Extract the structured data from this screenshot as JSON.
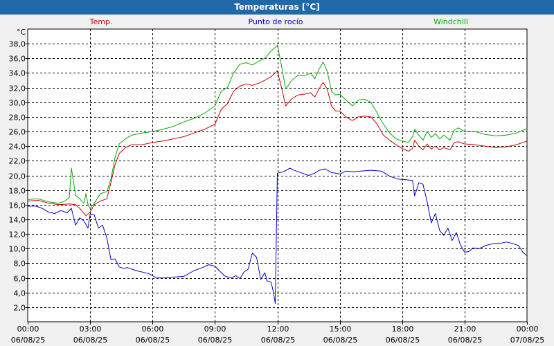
{
  "window": {
    "title": "Temperaturas [°C]"
  },
  "chart_data": {
    "type": "line",
    "title": "Temperaturas [°C]",
    "ylabel": "°C",
    "xlabel": "",
    "ylim": [
      0,
      40
    ],
    "xlim_hours": [
      0,
      24
    ],
    "y_ticks": [
      {
        "value": 2,
        "label": "2,0"
      },
      {
        "value": 4,
        "label": "4,0"
      },
      {
        "value": 6,
        "label": "6,0"
      },
      {
        "value": 8,
        "label": "8,0"
      },
      {
        "value": 10,
        "label": "10,0"
      },
      {
        "value": 12,
        "label": "12,0"
      },
      {
        "value": 14,
        "label": "14,0"
      },
      {
        "value": 16,
        "label": "16,0"
      },
      {
        "value": 18,
        "label": "18,0"
      },
      {
        "value": 20,
        "label": "20,0"
      },
      {
        "value": 22,
        "label": "22,0"
      },
      {
        "value": 24,
        "label": "24,0"
      },
      {
        "value": 26,
        "label": "26,0"
      },
      {
        "value": 28,
        "label": "28,0"
      },
      {
        "value": 30,
        "label": "30,0"
      },
      {
        "value": 32,
        "label": "32,0"
      },
      {
        "value": 34,
        "label": "34,0"
      },
      {
        "value": 36,
        "label": "36,0"
      },
      {
        "value": 38,
        "label": "38,0"
      }
    ],
    "x_ticks": [
      {
        "hour": 0,
        "time": "00:00",
        "date": "06/08/25"
      },
      {
        "hour": 3,
        "time": "03:00",
        "date": "06/08/25"
      },
      {
        "hour": 6,
        "time": "06:00",
        "date": "06/08/25"
      },
      {
        "hour": 9,
        "time": "09:00",
        "date": "06/08/25"
      },
      {
        "hour": 12,
        "time": "12:00",
        "date": "06/08/25"
      },
      {
        "hour": 15,
        "time": "15:00",
        "date": "06/08/25"
      },
      {
        "hour": 18,
        "time": "18:00",
        "date": "06/08/25"
      },
      {
        "hour": 21,
        "time": "21:00",
        "date": "06/08/25"
      },
      {
        "hour": 24,
        "time": "00:00",
        "date": "07/08/25"
      }
    ],
    "grid": true,
    "legend": "top",
    "series": [
      {
        "name": "Temp.",
        "color": "#cc0000",
        "points": [
          [
            0.0,
            16.5
          ],
          [
            0.5,
            16.6
          ],
          [
            1.0,
            16.2
          ],
          [
            1.5,
            16.0
          ],
          [
            2.0,
            16.1
          ],
          [
            2.3,
            16.0
          ],
          [
            2.5,
            15.5
          ],
          [
            2.8,
            14.5
          ],
          [
            3.0,
            15.0
          ],
          [
            3.2,
            16.0
          ],
          [
            3.5,
            16.5
          ],
          [
            3.8,
            16.8
          ],
          [
            4.0,
            19.0
          ],
          [
            4.2,
            21.5
          ],
          [
            4.4,
            23.0
          ],
          [
            4.7,
            23.8
          ],
          [
            5.0,
            24.2
          ],
          [
            5.5,
            24.2
          ],
          [
            6.0,
            24.5
          ],
          [
            6.5,
            24.7
          ],
          [
            7.0,
            25.0
          ],
          [
            7.5,
            25.3
          ],
          [
            8.0,
            25.8
          ],
          [
            8.5,
            26.3
          ],
          [
            9.0,
            27.0
          ],
          [
            9.3,
            29.0
          ],
          [
            9.6,
            29.8
          ],
          [
            9.9,
            31.5
          ],
          [
            10.2,
            32.2
          ],
          [
            10.5,
            32.5
          ],
          [
            10.8,
            32.3
          ],
          [
            11.1,
            32.6
          ],
          [
            11.4,
            33.0
          ],
          [
            11.7,
            33.5
          ],
          [
            11.9,
            34.0
          ],
          [
            12.0,
            34.3
          ],
          [
            12.2,
            32.0
          ],
          [
            12.4,
            29.5
          ],
          [
            12.7,
            30.5
          ],
          [
            13.0,
            31.0
          ],
          [
            13.3,
            31.1
          ],
          [
            13.6,
            31.3
          ],
          [
            13.8,
            30.7
          ],
          [
            14.0,
            31.8
          ],
          [
            14.2,
            32.7
          ],
          [
            14.4,
            31.8
          ],
          [
            14.6,
            29.5
          ],
          [
            14.8,
            28.8
          ],
          [
            15.0,
            28.8
          ],
          [
            15.3,
            28.0
          ],
          [
            15.6,
            27.5
          ],
          [
            15.9,
            28.0
          ],
          [
            16.2,
            28.1
          ],
          [
            16.5,
            28.0
          ],
          [
            16.8,
            27.0
          ],
          [
            17.1,
            25.5
          ],
          [
            17.4,
            24.8
          ],
          [
            17.7,
            24.2
          ],
          [
            18.0,
            23.7
          ],
          [
            18.3,
            23.3
          ],
          [
            18.5,
            23.7
          ],
          [
            18.6,
            24.8
          ],
          [
            18.8,
            24.0
          ],
          [
            19.0,
            23.5
          ],
          [
            19.2,
            24.3
          ],
          [
            19.4,
            23.6
          ],
          [
            19.6,
            24.0
          ],
          [
            19.8,
            23.5
          ],
          [
            20.0,
            23.8
          ],
          [
            20.3,
            23.5
          ],
          [
            20.5,
            24.5
          ],
          [
            20.7,
            24.6
          ],
          [
            21.0,
            24.3
          ],
          [
            21.5,
            24.2
          ],
          [
            22.0,
            24.0
          ],
          [
            22.5,
            23.8
          ],
          [
            23.0,
            23.9
          ],
          [
            23.5,
            24.2
          ],
          [
            24.0,
            24.7
          ]
        ]
      },
      {
        "name": "Punto de rocío",
        "color": "#0000cc",
        "points": [
          [
            0.0,
            15.8
          ],
          [
            0.4,
            15.8
          ],
          [
            0.7,
            15.5
          ],
          [
            1.0,
            15.0
          ],
          [
            1.3,
            14.8
          ],
          [
            1.6,
            15.2
          ],
          [
            1.9,
            14.9
          ],
          [
            2.1,
            15.5
          ],
          [
            2.3,
            13.2
          ],
          [
            2.5,
            14.2
          ],
          [
            2.7,
            13.8
          ],
          [
            2.9,
            12.8
          ],
          [
            3.0,
            14.7
          ],
          [
            3.2,
            14.6
          ],
          [
            3.4,
            12.8
          ],
          [
            3.6,
            13.2
          ],
          [
            3.8,
            11.5
          ],
          [
            4.0,
            8.5
          ],
          [
            4.2,
            8.6
          ],
          [
            4.4,
            7.5
          ],
          [
            4.6,
            7.3
          ],
          [
            4.8,
            7.4
          ],
          [
            5.2,
            7.0
          ],
          [
            5.8,
            6.6
          ],
          [
            6.2,
            6.0
          ],
          [
            6.6,
            6.0
          ],
          [
            7.0,
            6.1
          ],
          [
            7.5,
            6.2
          ],
          [
            8.0,
            7.0
          ],
          [
            8.4,
            7.4
          ],
          [
            8.7,
            7.8
          ],
          [
            9.0,
            7.6
          ],
          [
            9.2,
            7.0
          ],
          [
            9.5,
            6.2
          ],
          [
            9.8,
            6.0
          ],
          [
            10.0,
            6.3
          ],
          [
            10.2,
            5.9
          ],
          [
            10.4,
            6.8
          ],
          [
            10.6,
            7.2
          ],
          [
            10.8,
            9.4
          ],
          [
            11.0,
            8.8
          ],
          [
            11.2,
            5.8
          ],
          [
            11.4,
            6.7
          ],
          [
            11.5,
            5.6
          ],
          [
            11.7,
            5.4
          ],
          [
            11.8,
            4.2
          ],
          [
            11.9,
            2.5
          ],
          [
            12.0,
            20.3
          ],
          [
            12.3,
            20.5
          ],
          [
            12.6,
            21.0
          ],
          [
            12.9,
            20.6
          ],
          [
            13.2,
            20.3
          ],
          [
            13.5,
            20.0
          ],
          [
            13.8,
            20.3
          ],
          [
            14.0,
            20.7
          ],
          [
            14.3,
            20.9
          ],
          [
            14.6,
            20.4
          ],
          [
            15.0,
            20.2
          ],
          [
            15.3,
            20.6
          ],
          [
            15.7,
            20.5
          ],
          [
            16.0,
            20.6
          ],
          [
            16.5,
            20.7
          ],
          [
            17.0,
            20.6
          ],
          [
            17.4,
            19.9
          ],
          [
            17.8,
            19.5
          ],
          [
            18.2,
            19.4
          ],
          [
            18.5,
            19.3
          ],
          [
            18.6,
            17.2
          ],
          [
            18.8,
            19.0
          ],
          [
            19.0,
            18.8
          ],
          [
            19.2,
            16.4
          ],
          [
            19.4,
            13.5
          ],
          [
            19.6,
            14.8
          ],
          [
            19.8,
            12.5
          ],
          [
            20.0,
            11.8
          ],
          [
            20.2,
            12.8
          ],
          [
            20.4,
            11.1
          ],
          [
            20.6,
            12.2
          ],
          [
            20.8,
            10.5
          ],
          [
            21.0,
            9.5
          ],
          [
            21.2,
            9.6
          ],
          [
            21.4,
            10.1
          ],
          [
            21.7,
            10.0
          ],
          [
            22.0,
            10.4
          ],
          [
            22.4,
            10.7
          ],
          [
            22.7,
            10.7
          ],
          [
            23.0,
            10.9
          ],
          [
            23.3,
            10.7
          ],
          [
            23.6,
            10.4
          ],
          [
            23.8,
            9.5
          ],
          [
            24.0,
            9.0
          ]
        ]
      },
      {
        "name": "Windchill",
        "color": "#00aa00",
        "points": [
          [
            0.0,
            16.7
          ],
          [
            0.5,
            16.8
          ],
          [
            1.0,
            16.4
          ],
          [
            1.5,
            16.2
          ],
          [
            1.8,
            16.5
          ],
          [
            2.0,
            17.0
          ],
          [
            2.1,
            21.0
          ],
          [
            2.3,
            17.3
          ],
          [
            2.5,
            16.8
          ],
          [
            2.7,
            16.2
          ],
          [
            2.8,
            17.5
          ],
          [
            2.9,
            16.0
          ],
          [
            3.0,
            15.5
          ],
          [
            3.2,
            16.2
          ],
          [
            3.5,
            17.5
          ],
          [
            3.8,
            17.8
          ],
          [
            4.0,
            19.5
          ],
          [
            4.2,
            22.5
          ],
          [
            4.4,
            24.3
          ],
          [
            4.7,
            25.0
          ],
          [
            5.0,
            25.5
          ],
          [
            5.5,
            25.8
          ],
          [
            6.0,
            26.0
          ],
          [
            6.5,
            26.3
          ],
          [
            7.0,
            26.7
          ],
          [
            7.5,
            27.3
          ],
          [
            8.0,
            27.8
          ],
          [
            8.5,
            28.5
          ],
          [
            9.0,
            29.5
          ],
          [
            9.3,
            31.5
          ],
          [
            9.6,
            32.0
          ],
          [
            9.9,
            34.0
          ],
          [
            10.2,
            35.2
          ],
          [
            10.5,
            35.4
          ],
          [
            10.8,
            35.1
          ],
          [
            11.1,
            35.6
          ],
          [
            11.4,
            36.0
          ],
          [
            11.7,
            37.0
          ],
          [
            11.9,
            37.5
          ],
          [
            12.0,
            37.8
          ],
          [
            12.2,
            35.0
          ],
          [
            12.4,
            31.8
          ],
          [
            12.7,
            33.0
          ],
          [
            13.0,
            33.7
          ],
          [
            13.3,
            33.6
          ],
          [
            13.6,
            34.0
          ],
          [
            13.8,
            33.2
          ],
          [
            14.0,
            34.5
          ],
          [
            14.2,
            35.5
          ],
          [
            14.4,
            34.2
          ],
          [
            14.6,
            31.5
          ],
          [
            14.8,
            31.0
          ],
          [
            15.0,
            31.1
          ],
          [
            15.3,
            30.3
          ],
          [
            15.6,
            29.5
          ],
          [
            15.9,
            30.3
          ],
          [
            16.2,
            30.4
          ],
          [
            16.5,
            30.0
          ],
          [
            16.8,
            28.5
          ],
          [
            17.1,
            27.0
          ],
          [
            17.4,
            25.8
          ],
          [
            17.7,
            25.0
          ],
          [
            18.0,
            24.7
          ],
          [
            18.3,
            24.5
          ],
          [
            18.5,
            25.3
          ],
          [
            18.6,
            26.3
          ],
          [
            18.8,
            25.5
          ],
          [
            19.0,
            24.8
          ],
          [
            19.2,
            26.0
          ],
          [
            19.4,
            25.2
          ],
          [
            19.6,
            25.7
          ],
          [
            19.8,
            25.0
          ],
          [
            20.0,
            25.5
          ],
          [
            20.3,
            24.8
          ],
          [
            20.5,
            26.2
          ],
          [
            20.7,
            26.5
          ],
          [
            21.0,
            26.0
          ],
          [
            21.5,
            26.0
          ],
          [
            22.0,
            25.6
          ],
          [
            22.5,
            25.4
          ],
          [
            23.0,
            25.5
          ],
          [
            23.5,
            25.8
          ],
          [
            24.0,
            26.4
          ]
        ]
      }
    ]
  }
}
